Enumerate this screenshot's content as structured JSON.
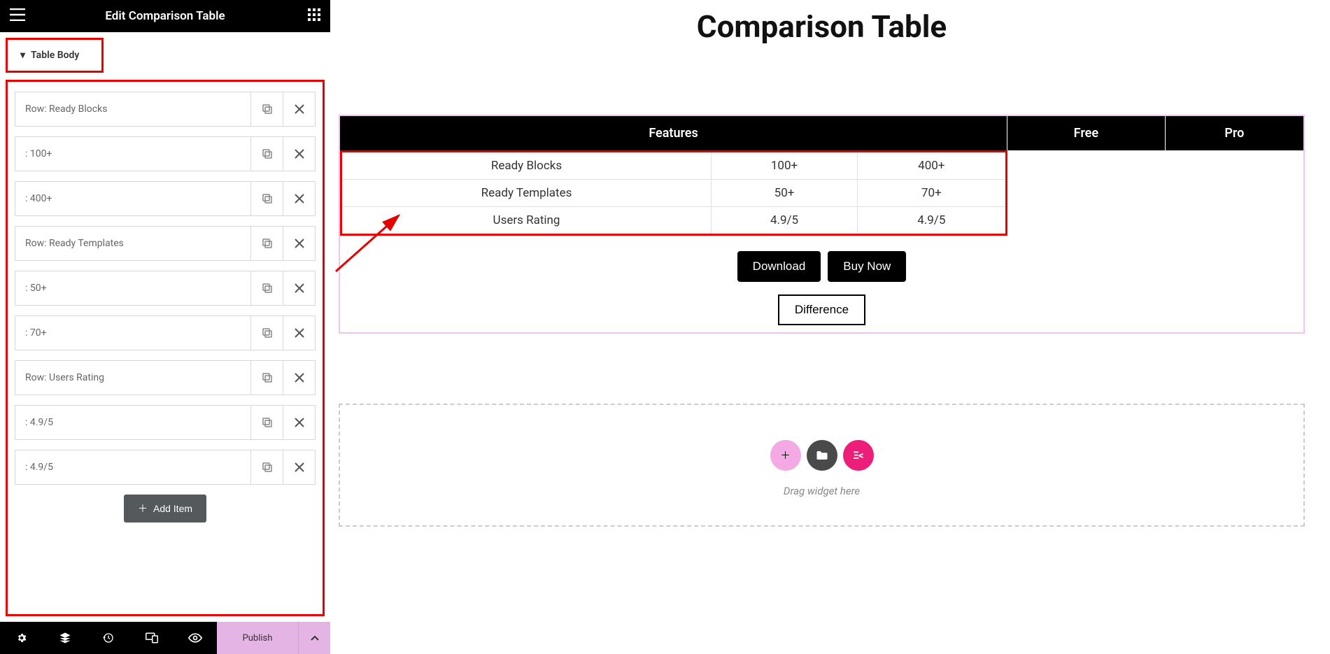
{
  "panel": {
    "title": "Edit Comparison Table",
    "section_label": "Table Body",
    "items": [
      {
        "label": "Row: Ready Blocks"
      },
      {
        "label": ": 100+"
      },
      {
        "label": ": 400+"
      },
      {
        "label": "Row: Ready Templates"
      },
      {
        "label": ": 50+"
      },
      {
        "label": ": 70+"
      },
      {
        "label": "Row: Users Rating"
      },
      {
        "label": ": 4.9/5"
      },
      {
        "label": ": 4.9/5"
      }
    ],
    "add_item": "Add Item",
    "publish": "Publish"
  },
  "preview": {
    "heading": "Comparison Table",
    "columns": [
      "Features",
      "Free",
      "Pro"
    ],
    "rows": [
      [
        "Ready Blocks",
        "100+",
        "400+"
      ],
      [
        "Ready Templates",
        "50+",
        "70+"
      ],
      [
        "Users Rating",
        "4.9/5",
        "4.9/5"
      ]
    ],
    "buttons": {
      "download": "Download",
      "buy": "Buy Now",
      "diff": "Difference"
    },
    "drop_text": "Drag widget here"
  }
}
